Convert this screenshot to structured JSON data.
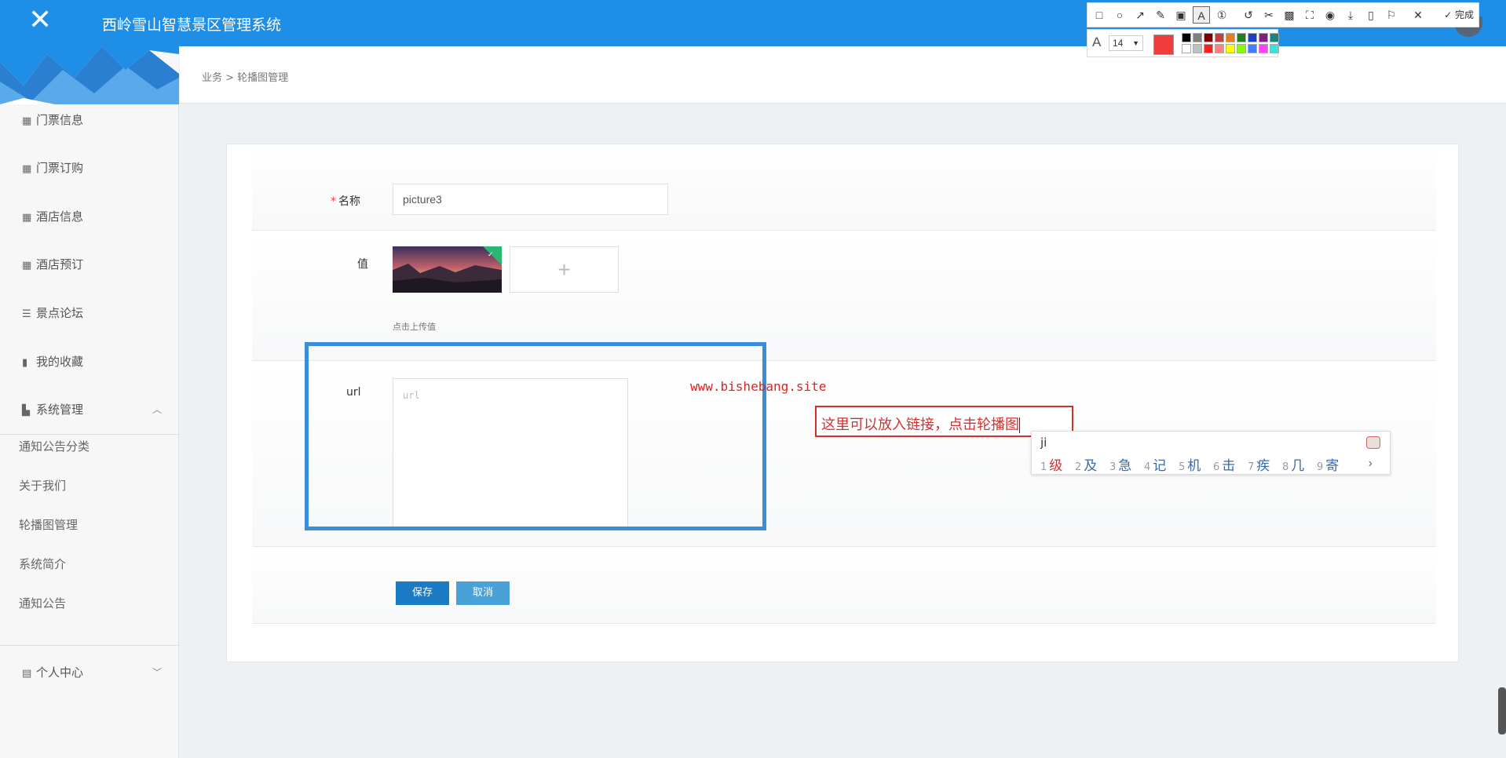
{
  "app": {
    "title": "西岭雪山智慧景区管理系统",
    "close_icon": "close-icon"
  },
  "breadcrumb": {
    "text": "业务 > 轮播图管理"
  },
  "sidebar": {
    "items": [
      {
        "label": "门票信息",
        "icon": "grid-icon"
      },
      {
        "label": "门票订购",
        "icon": "grid-icon"
      },
      {
        "label": "酒店信息",
        "icon": "grid-icon"
      },
      {
        "label": "酒店预订",
        "icon": "grid-icon"
      },
      {
        "label": "景点论坛",
        "icon": "list-icon"
      },
      {
        "label": "我的收藏",
        "icon": "bar-chart-icon"
      },
      {
        "label": "系统管理",
        "icon": "book-icon",
        "expanded": true
      }
    ],
    "sub_items": [
      {
        "label": "通知公告分类"
      },
      {
        "label": "关于我们"
      },
      {
        "label": "轮播图管理"
      },
      {
        "label": "系统简介"
      },
      {
        "label": "通知公告"
      }
    ],
    "personal": {
      "label": "个人中心",
      "icon": "calendar-icon",
      "expanded": false
    }
  },
  "form": {
    "name": {
      "required_mark": "*",
      "label": "名称",
      "value": "picture3"
    },
    "value": {
      "label": "值",
      "hint": "点击上传值",
      "upload_icon": "plus-icon"
    },
    "url": {
      "label": "url",
      "placeholder": "url"
    },
    "buttons": {
      "save": "保存",
      "cancel": "取消"
    }
  },
  "annotation": {
    "watermark": "www.bishebang.site",
    "textbox_text": "这里可以放入链接，点击轮播图"
  },
  "ime": {
    "pinyin": "ji",
    "candidates": [
      {
        "n": "1",
        "c": "级"
      },
      {
        "n": "2",
        "c": "及"
      },
      {
        "n": "3",
        "c": "急"
      },
      {
        "n": "4",
        "c": "记"
      },
      {
        "n": "5",
        "c": "机"
      },
      {
        "n": "6",
        "c": "击"
      },
      {
        "n": "7",
        "c": "疾"
      },
      {
        "n": "8",
        "c": "几"
      },
      {
        "n": "9",
        "c": "寄"
      }
    ],
    "next": "›"
  },
  "screenshot_tool": {
    "done_label": "完成",
    "font_size": "14",
    "current_color": "#f03c3c",
    "palette": [
      "#000000",
      "#808080",
      "#800000",
      "#c04040",
      "#e08020",
      "#208020",
      "#2040c0",
      "#802080",
      "#208080",
      "#ffffff",
      "#c0c0c0",
      "#ff2020",
      "#ff8080",
      "#ffff00",
      "#80ff00",
      "#4080ff",
      "#ff40ff",
      "#40e0e0"
    ]
  },
  "colors": {
    "header": "#1f8ee6",
    "save_button": "#1a7ac4",
    "cancel_button": "#4aa1d8",
    "annotation_blue": "#3a8ed8",
    "annotation_red": "#d43030"
  }
}
